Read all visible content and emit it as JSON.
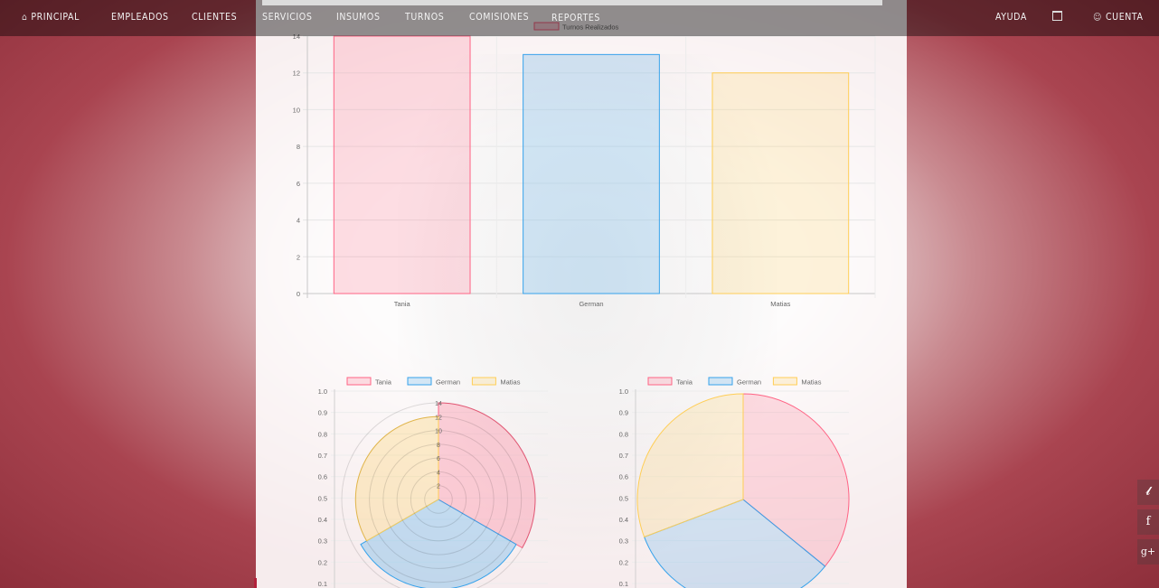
{
  "nav": {
    "items": [
      {
        "label": "PRINCIPAL",
        "icon": "home-icon"
      },
      {
        "label": "EMPLEADOS"
      },
      {
        "label": "CLIENTES"
      },
      {
        "label": "SERVICIOS"
      },
      {
        "label": "INSUMOS"
      },
      {
        "label": "TURNOS"
      },
      {
        "label": "COMISIONES"
      },
      {
        "label": "REPORTES"
      }
    ],
    "ayuda": "AYUDA",
    "calendar_icon": "calendar-icon",
    "cuenta": "CUENTA",
    "cuenta_icon": "user-icon"
  },
  "social": [
    "twitter-icon",
    "facebook-icon",
    "google-plus-icon"
  ],
  "colors": {
    "tania_fill": "rgba(255,99,132,0.2)",
    "tania_border": "#ff6384",
    "german_fill": "rgba(54,162,235,0.2)",
    "german_border": "#36a2eb",
    "matias_fill": "rgba(255,206,86,0.2)",
    "matias_border": "#ffce56"
  },
  "chart_data": [
    {
      "type": "bar",
      "categories": [
        "Tania",
        "German",
        "Matias"
      ],
      "series": [
        {
          "name": "Turnos Realizados",
          "values": [
            14,
            13,
            12
          ]
        }
      ],
      "ylim": [
        0,
        14
      ],
      "yticks": [
        0,
        2,
        4,
        6,
        8,
        10,
        12,
        14
      ],
      "grid": true,
      "legend": "top"
    },
    {
      "type": "polarArea",
      "categories": [
        "Tania",
        "German",
        "Matias"
      ],
      "values": [
        14,
        13,
        12
      ],
      "rticks": [
        2,
        4,
        6,
        8,
        10,
        12,
        14
      ],
      "yticks": [
        "0.1",
        "0.2",
        "0.3",
        "0.4",
        "0.5",
        "0.6",
        "0.7",
        "0.8",
        "0.9",
        "1.0"
      ],
      "legend": "top"
    },
    {
      "type": "pie",
      "categories": [
        "Tania",
        "German",
        "Matias"
      ],
      "values": [
        14,
        13,
        12
      ],
      "yticks": [
        "0.1",
        "0.2",
        "0.3",
        "0.4",
        "0.5",
        "0.6",
        "0.7",
        "0.8",
        "0.9",
        "1.0"
      ],
      "legend": "top"
    }
  ]
}
